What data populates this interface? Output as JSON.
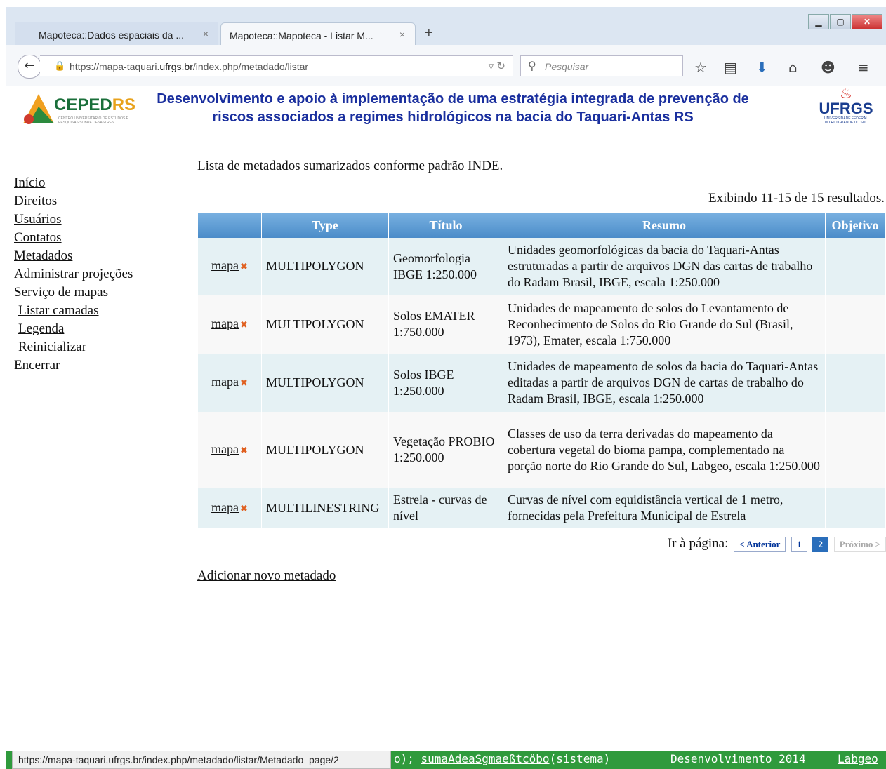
{
  "browser": {
    "tabs": [
      {
        "label": "Mapoteca::Dados espaciais da ...",
        "close": "×"
      },
      {
        "label": "Mapoteca::Mapoteca - Listar M...",
        "close": "×"
      }
    ],
    "new_tab": "+",
    "url_prefix": "https://mapa-taquari.",
    "url_domain": "ufrgs.br",
    "url_suffix": "/index.php/metadado/listar",
    "search_placeholder": "Pesquisar",
    "window_buttons": {
      "minimize": "▁",
      "maximize": "▢",
      "close": "✕"
    }
  },
  "header": {
    "left_logo": {
      "part1": "CEPED",
      "part2": "RS",
      "sub": "CENTRO UNIVERSITÁRIO DE ESTUDOS E PESQUISAS SOBRE DESASTRES"
    },
    "title_line1": "Desenvolvimento e apoio à implementação de uma estratégia integrada de prevenção de",
    "title_line2": "riscos associados a regimes hidrológicos na bacia do Taquari-Antas RS",
    "right_logo": {
      "name": "UFRGS",
      "sub1": "UNIVERSIDADE FEDERAL",
      "sub2": "DO RIO GRANDE DO SUL"
    }
  },
  "menu": {
    "inicio": "Início",
    "direitos": "Direitos",
    "usuarios": "Usuários",
    "contatos": "Contatos",
    "metadados": "Metadados",
    "administrar": "Administrar projeções",
    "servico": "Serviço de mapas",
    "listar": "Listar camadas",
    "legenda": "Legenda",
    "reiniciar": "Reinicializar",
    "encerrar": "Encerrar"
  },
  "main": {
    "intro": "Lista de metadados sumarizados conforme padrão INDE.",
    "summary": "Exibindo 11-15 de 15 resultados.",
    "columns": [
      "",
      "Type",
      "Título",
      "Resumo",
      "Objetivo"
    ],
    "rows": [
      {
        "link": "mapa",
        "type": "MULTIPOLYGON",
        "titulo": "Geomorfologia IBGE 1:250.000",
        "resumo": "Unidades geomorfológicas da bacia do Taquari-Antas estruturadas a partir de arquivos DGN das cartas de trabalho do Radam Brasil, IBGE, escala 1:250.000",
        "objetivo": ""
      },
      {
        "link": "mapa",
        "type": "MULTIPOLYGON",
        "titulo": "Solos EMATER 1:750.000",
        "resumo": "Unidades de mapeamento de solos do Levantamento de Reconhecimento de Solos do Rio Grande do Sul (Brasil, 1973), Emater, escala 1:750.000",
        "objetivo": ""
      },
      {
        "link": "mapa",
        "type": "MULTIPOLYGON",
        "titulo": "Solos IBGE 1:250.000",
        "resumo": "Unidades de mapeamento de solos da bacia do Taquari-Antas editadas a partir de arquivos DGN de cartas de trabalho do Radam Brasil, IBGE, escala 1:250.000",
        "objetivo": ""
      },
      {
        "link": "mapa",
        "type": "MULTIPOLYGON",
        "titulo": "Vegetação PROBIO 1:250.000",
        "resumo": "Classes de uso da terra derivadas do mapeamento da cobertura vegetal do bioma pampa, complementado na porção norte do Rio Grande do Sul, Labgeo, escala 1:250.000",
        "objetivo": ""
      },
      {
        "link": "mapa",
        "type": "MULTILINESTRING",
        "titulo": "Estrela - curvas de nível",
        "resumo": "Curvas de nível com equidistância vertical de 1 metro, fornecidas pela Prefeitura Municipal de Estrela",
        "objetivo": ""
      }
    ],
    "pager": {
      "label": "Ir à página:",
      "prev": "< Anterior",
      "pages": [
        "1",
        "2"
      ],
      "next": "Próximo >"
    },
    "add_new": "Adicionar novo metadado"
  },
  "statusbar": {
    "url": "https://mapa-taquari.ufrgs.br/index.php/metadado/listar/Metadado_page/2",
    "footer_text1": "o); ",
    "footer_link": "sumaAdeaSgmaeßtcöbo",
    "footer_text2": "(sistema)",
    "footer_dev": "Desenvolvimento 2014",
    "footer_lab": "Labgeo"
  }
}
